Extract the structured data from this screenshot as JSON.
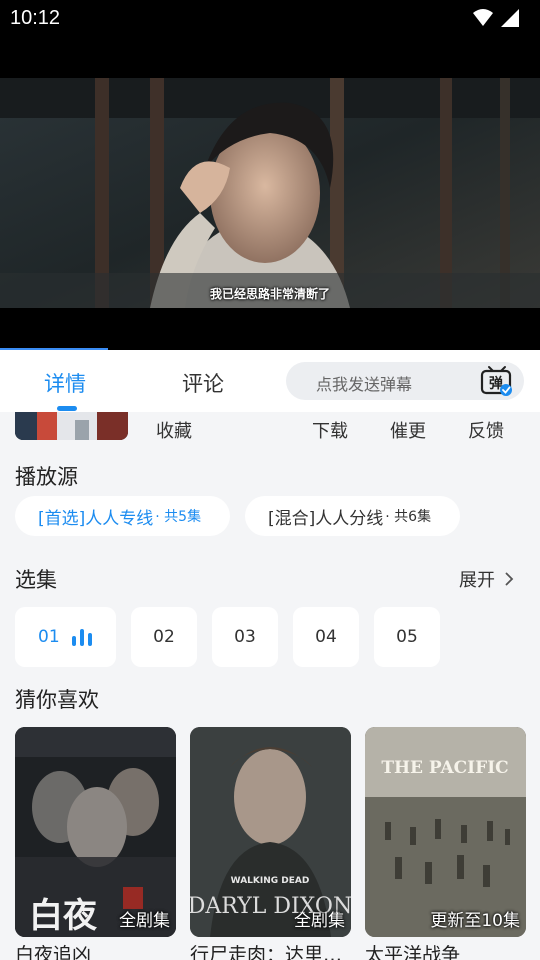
{
  "status_bar": {
    "time": "10:12",
    "wifi_icon": "wifi-icon",
    "signal_icon": "signal-icon"
  },
  "player": {
    "subtitle": "我已经思路非常清断了",
    "progress_fraction": 0.2
  },
  "tabs": [
    {
      "label": "详情",
      "active": true
    },
    {
      "label": "评论",
      "active": false
    }
  ],
  "danmu": {
    "placeholder": "点我发送弹幕",
    "icon_text": "弹"
  },
  "actions": {
    "favorite": "收藏",
    "download": "下载",
    "urge": "催更",
    "feedback": "反馈"
  },
  "sources": {
    "title": "播放源",
    "items": [
      {
        "label": "[首选]人人专线",
        "count": "· 共5集",
        "active": true
      },
      {
        "label": "[混合]人人分线",
        "count": "· 共6集",
        "active": false
      }
    ]
  },
  "episodes": {
    "title": "选集",
    "expand": "展开",
    "items": [
      "01",
      "02",
      "03",
      "04",
      "05"
    ],
    "active_index": 0
  },
  "recommend": {
    "title": "猜你喜欢",
    "items": [
      {
        "title": "白夜追凶",
        "badge": "全剧集",
        "poster_text": "白夜"
      },
      {
        "title": "行尸走肉：达里尔·迪克森",
        "badge": "全剧集",
        "poster_text": "DARYL DIXON",
        "poster_subtext": "WALKING DEAD"
      },
      {
        "title": "太平洋战争",
        "badge": "更新至10集",
        "poster_text": "THE PACIFIC"
      }
    ]
  },
  "colors": {
    "accent": "#1c8cf0",
    "background": "#f4f5f7"
  }
}
